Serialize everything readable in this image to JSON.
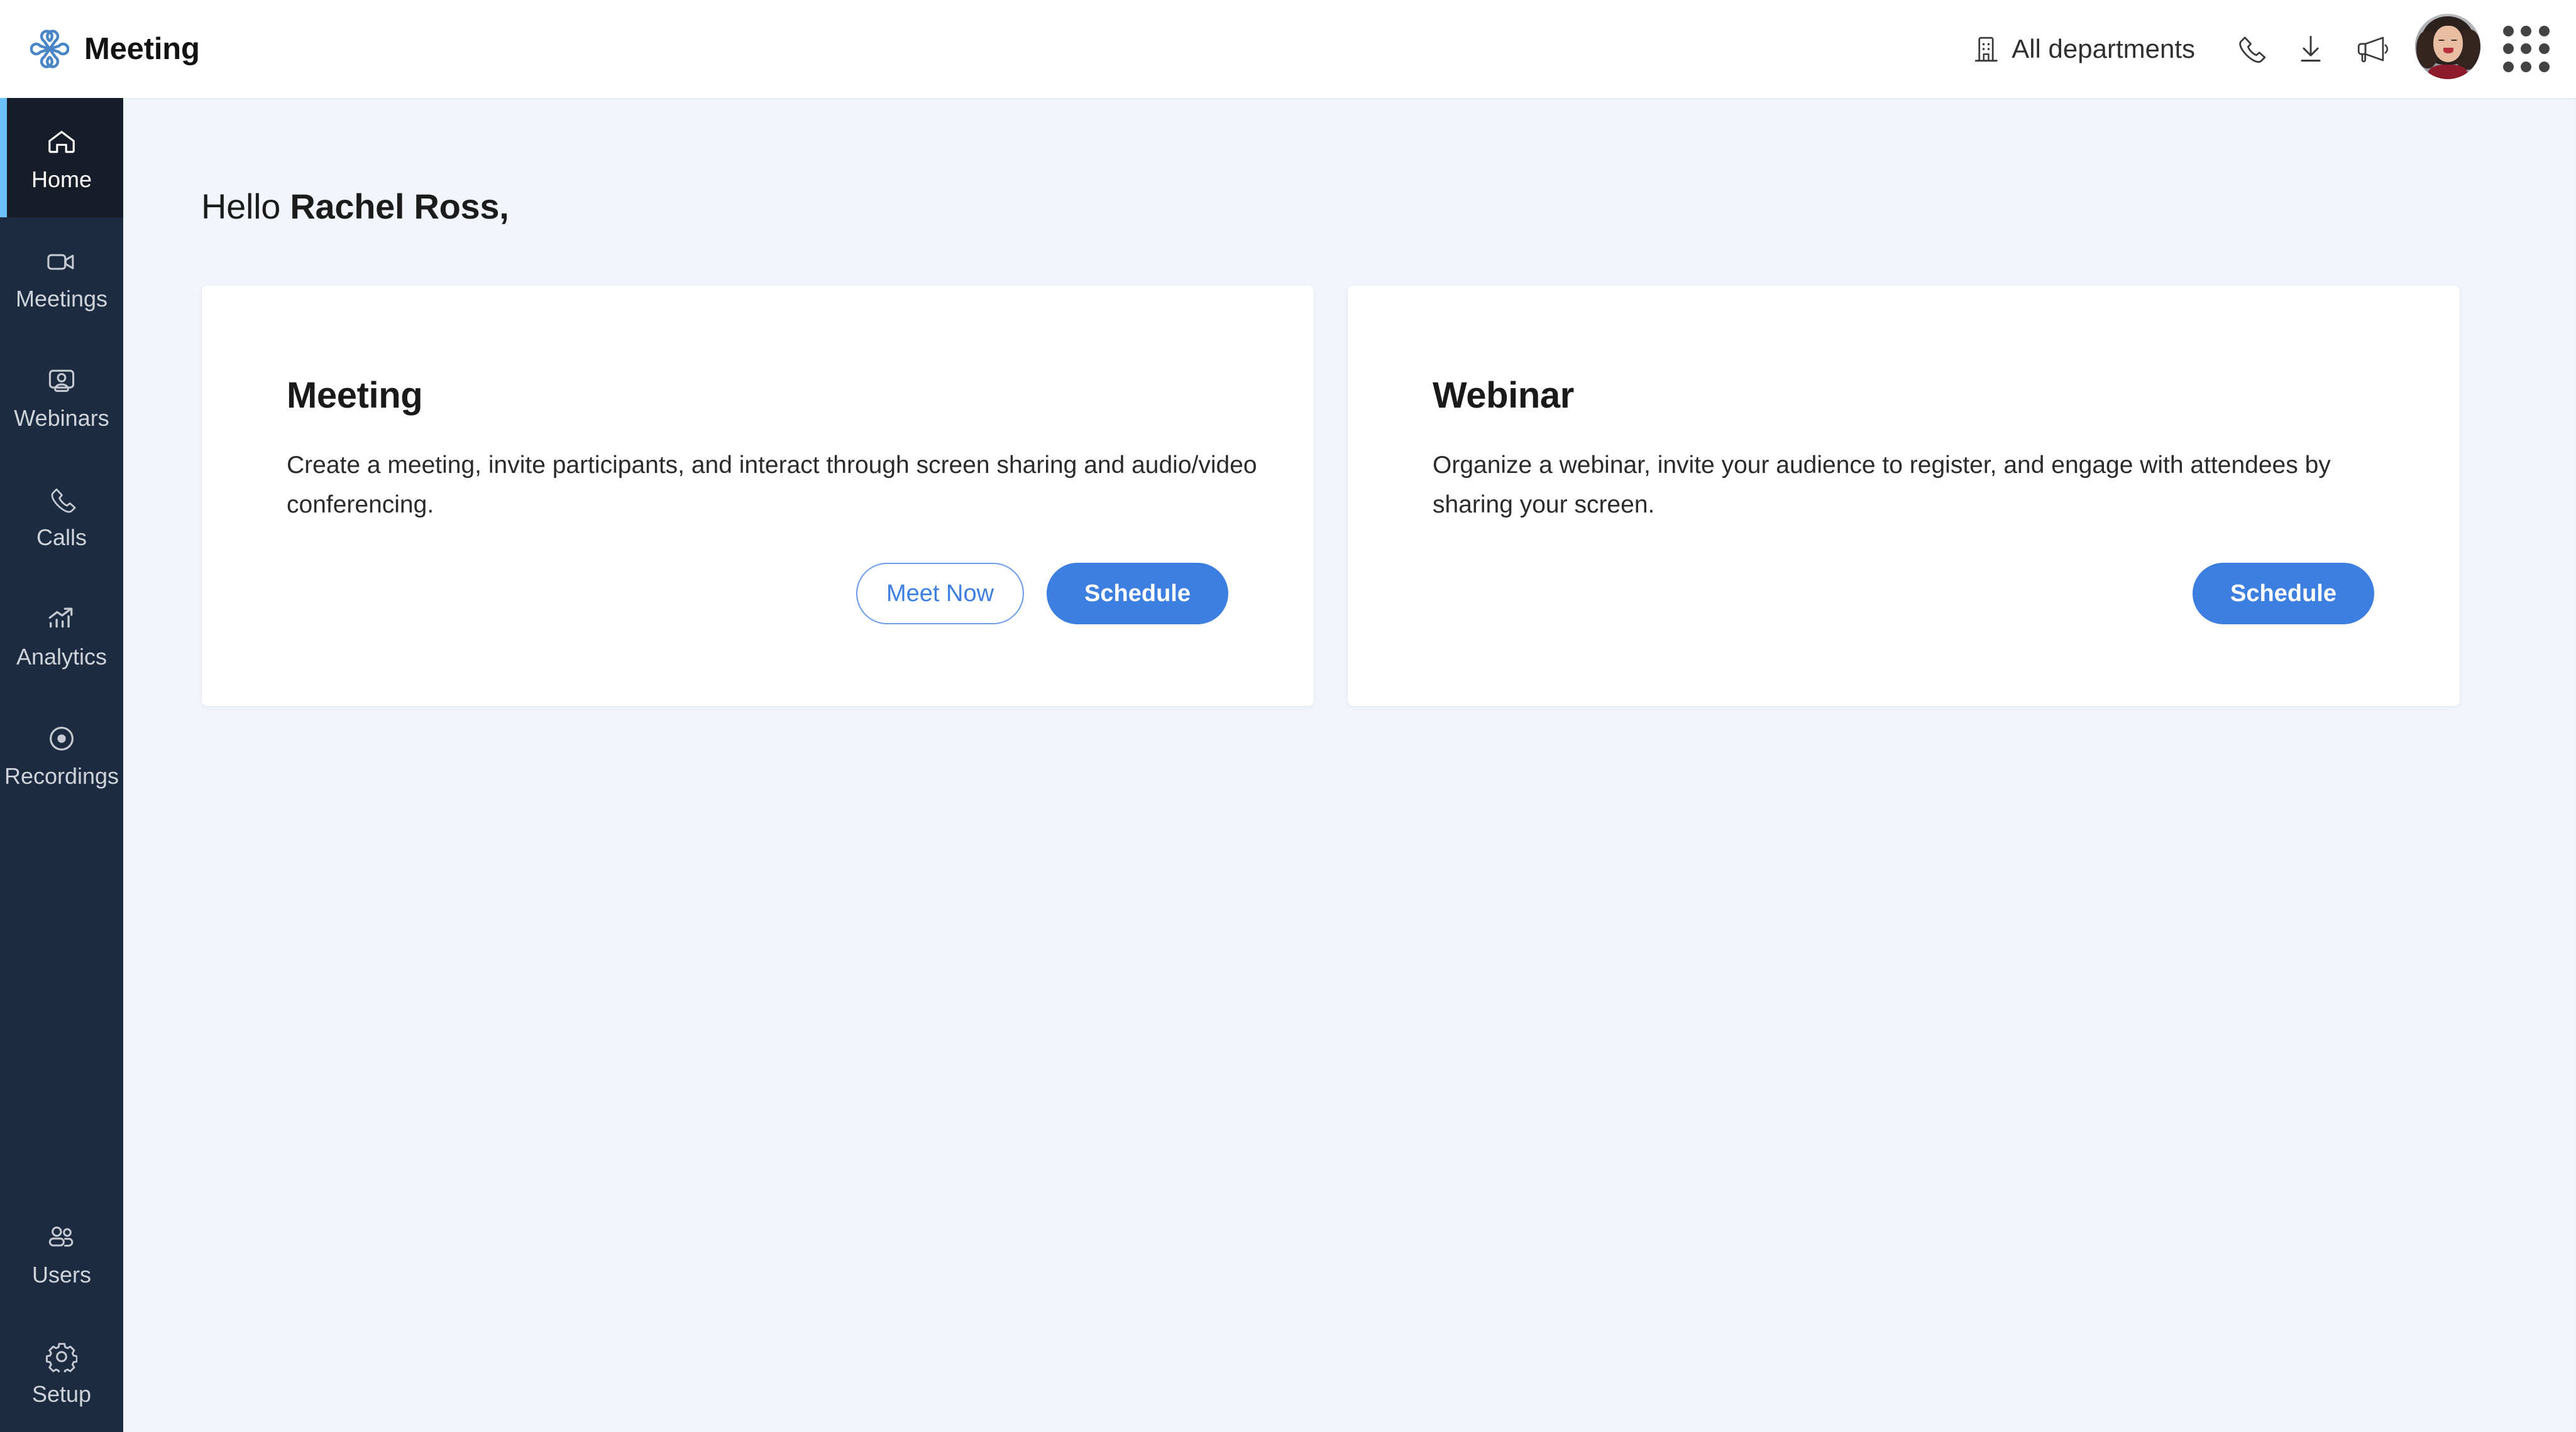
{
  "app": {
    "title": "Meeting",
    "logo_icon": "zoho-meeting-logo-icon",
    "accent_blue": "#3d7fe0",
    "logo_blue": "#4a86c5",
    "sidebar_bg": "#1d2b41",
    "sidebar_active_bg": "#161d28",
    "sidebar_active_accent": "#6cc0fb",
    "main_bg": "#f2f6fc"
  },
  "header": {
    "department_selector": {
      "icon": "building-icon",
      "label": "All departments"
    },
    "icons": [
      {
        "name": "phone-icon",
        "label": "Phone"
      },
      {
        "name": "download-icon",
        "label": "Download"
      },
      {
        "name": "megaphone-icon",
        "label": "Announcements"
      }
    ],
    "avatar": {
      "name": "user-avatar",
      "label": "Rachel Ross"
    },
    "apps_grid": {
      "name": "apps-grid-icon",
      "label": "Apps"
    }
  },
  "sidebar": {
    "items": [
      {
        "label": "Home",
        "icon": "home-icon",
        "active": true
      },
      {
        "label": "Meetings",
        "icon": "video-camera-icon",
        "active": false
      },
      {
        "label": "Webinars",
        "icon": "webinar-icon",
        "active": false
      },
      {
        "label": "Calls",
        "icon": "phone-icon",
        "active": false
      },
      {
        "label": "Analytics",
        "icon": "bar-chart-icon",
        "active": false
      },
      {
        "label": "Recordings",
        "icon": "record-icon",
        "active": false
      }
    ],
    "bottom_items": [
      {
        "label": "Users",
        "icon": "users-icon"
      },
      {
        "label": "Setup",
        "icon": "gear-icon"
      }
    ]
  },
  "main": {
    "greeting_prefix": "Hello ",
    "greeting_name": "Rachel Ross,",
    "cards": [
      {
        "title": "Meeting",
        "description": "Create a meeting, invite participants, and interact through screen sharing and audio/video conferencing.",
        "buttons": [
          {
            "label": "Meet Now",
            "style": "outline"
          },
          {
            "label": "Schedule",
            "style": "primary"
          }
        ]
      },
      {
        "title": "Webinar",
        "description": "Organize a webinar, invite your audience to register, and engage with attendees by sharing your screen.",
        "buttons": [
          {
            "label": "Schedule",
            "style": "primary"
          }
        ]
      }
    ]
  }
}
